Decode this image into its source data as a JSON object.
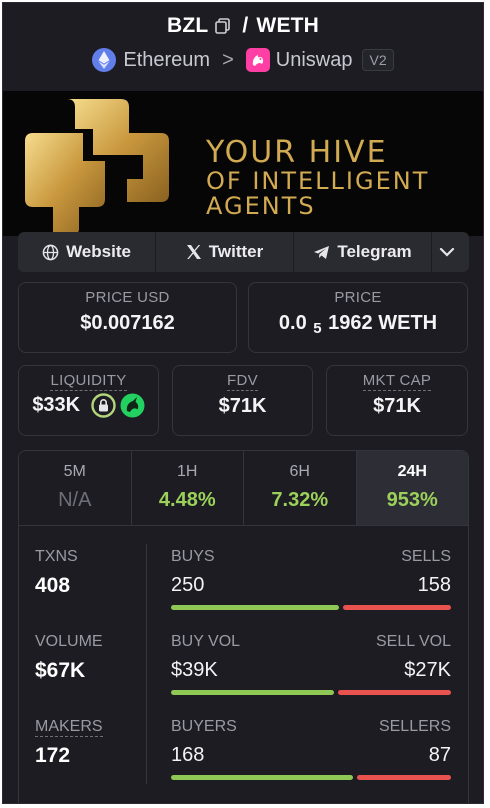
{
  "header": {
    "base_token": "BZL",
    "separator": "/",
    "quote_token": "WETH",
    "chain": "Ethereum",
    "chevron": ">",
    "dex": "Uniswap",
    "dex_version": "V2"
  },
  "banner": {
    "line1": "YOUR HIVE",
    "line2": "OF INTELLIGENT",
    "line3": "AGENTS",
    "accent_color": "#d2aa52"
  },
  "links": {
    "website": "Website",
    "twitter": "Twitter",
    "telegram": "Telegram"
  },
  "price": {
    "usd_label": "PRICE USD",
    "usd_value": "$0.007162",
    "native_label": "PRICE",
    "native_prefix": "0.0",
    "native_zeros": "5",
    "native_digits": "1962 WETH"
  },
  "metrics": {
    "liquidity_label": "LIQUIDITY",
    "liquidity_value": "$33K",
    "fdv_label": "FDV",
    "fdv_value": "$71K",
    "mktcap_label": "MKT CAP",
    "mktcap_value": "$71K"
  },
  "timeframes": [
    {
      "label": "5M",
      "value": "N/A"
    },
    {
      "label": "1H",
      "value": "4.48%"
    },
    {
      "label": "6H",
      "value": "7.32%"
    },
    {
      "label": "24H",
      "value": "953%"
    }
  ],
  "stats": {
    "txns_label": "TXNS",
    "txns_value": "408",
    "volume_label": "VOLUME",
    "volume_value": "$67K",
    "makers_label": "MAKERS",
    "makers_value": "172",
    "buys_label": "BUYS",
    "buys_value": "250",
    "sells_label": "SELLS",
    "sells_value": "158",
    "buy_vol_label": "BUY VOL",
    "buy_vol_value": "$39K",
    "sell_vol_label": "SELL VOL",
    "sell_vol_value": "$27K",
    "buyers_label": "BUYERS",
    "buyers_value": "168",
    "sellers_label": "SELLERS",
    "sellers_value": "87",
    "buy_ratio": 0.61,
    "buy_vol_ratio": 0.59,
    "buyers_ratio": 0.66
  },
  "colors": {
    "positive": "#9bd15a",
    "buy_bar": "#8fc855",
    "sell_bar": "#e9534f"
  },
  "icons": [
    "copy-icon",
    "ethereum-icon",
    "uniswap-icon",
    "globe-icon",
    "x-icon",
    "telegram-icon",
    "chevron-down-icon",
    "lock-icon",
    "unicorn-icon"
  ]
}
